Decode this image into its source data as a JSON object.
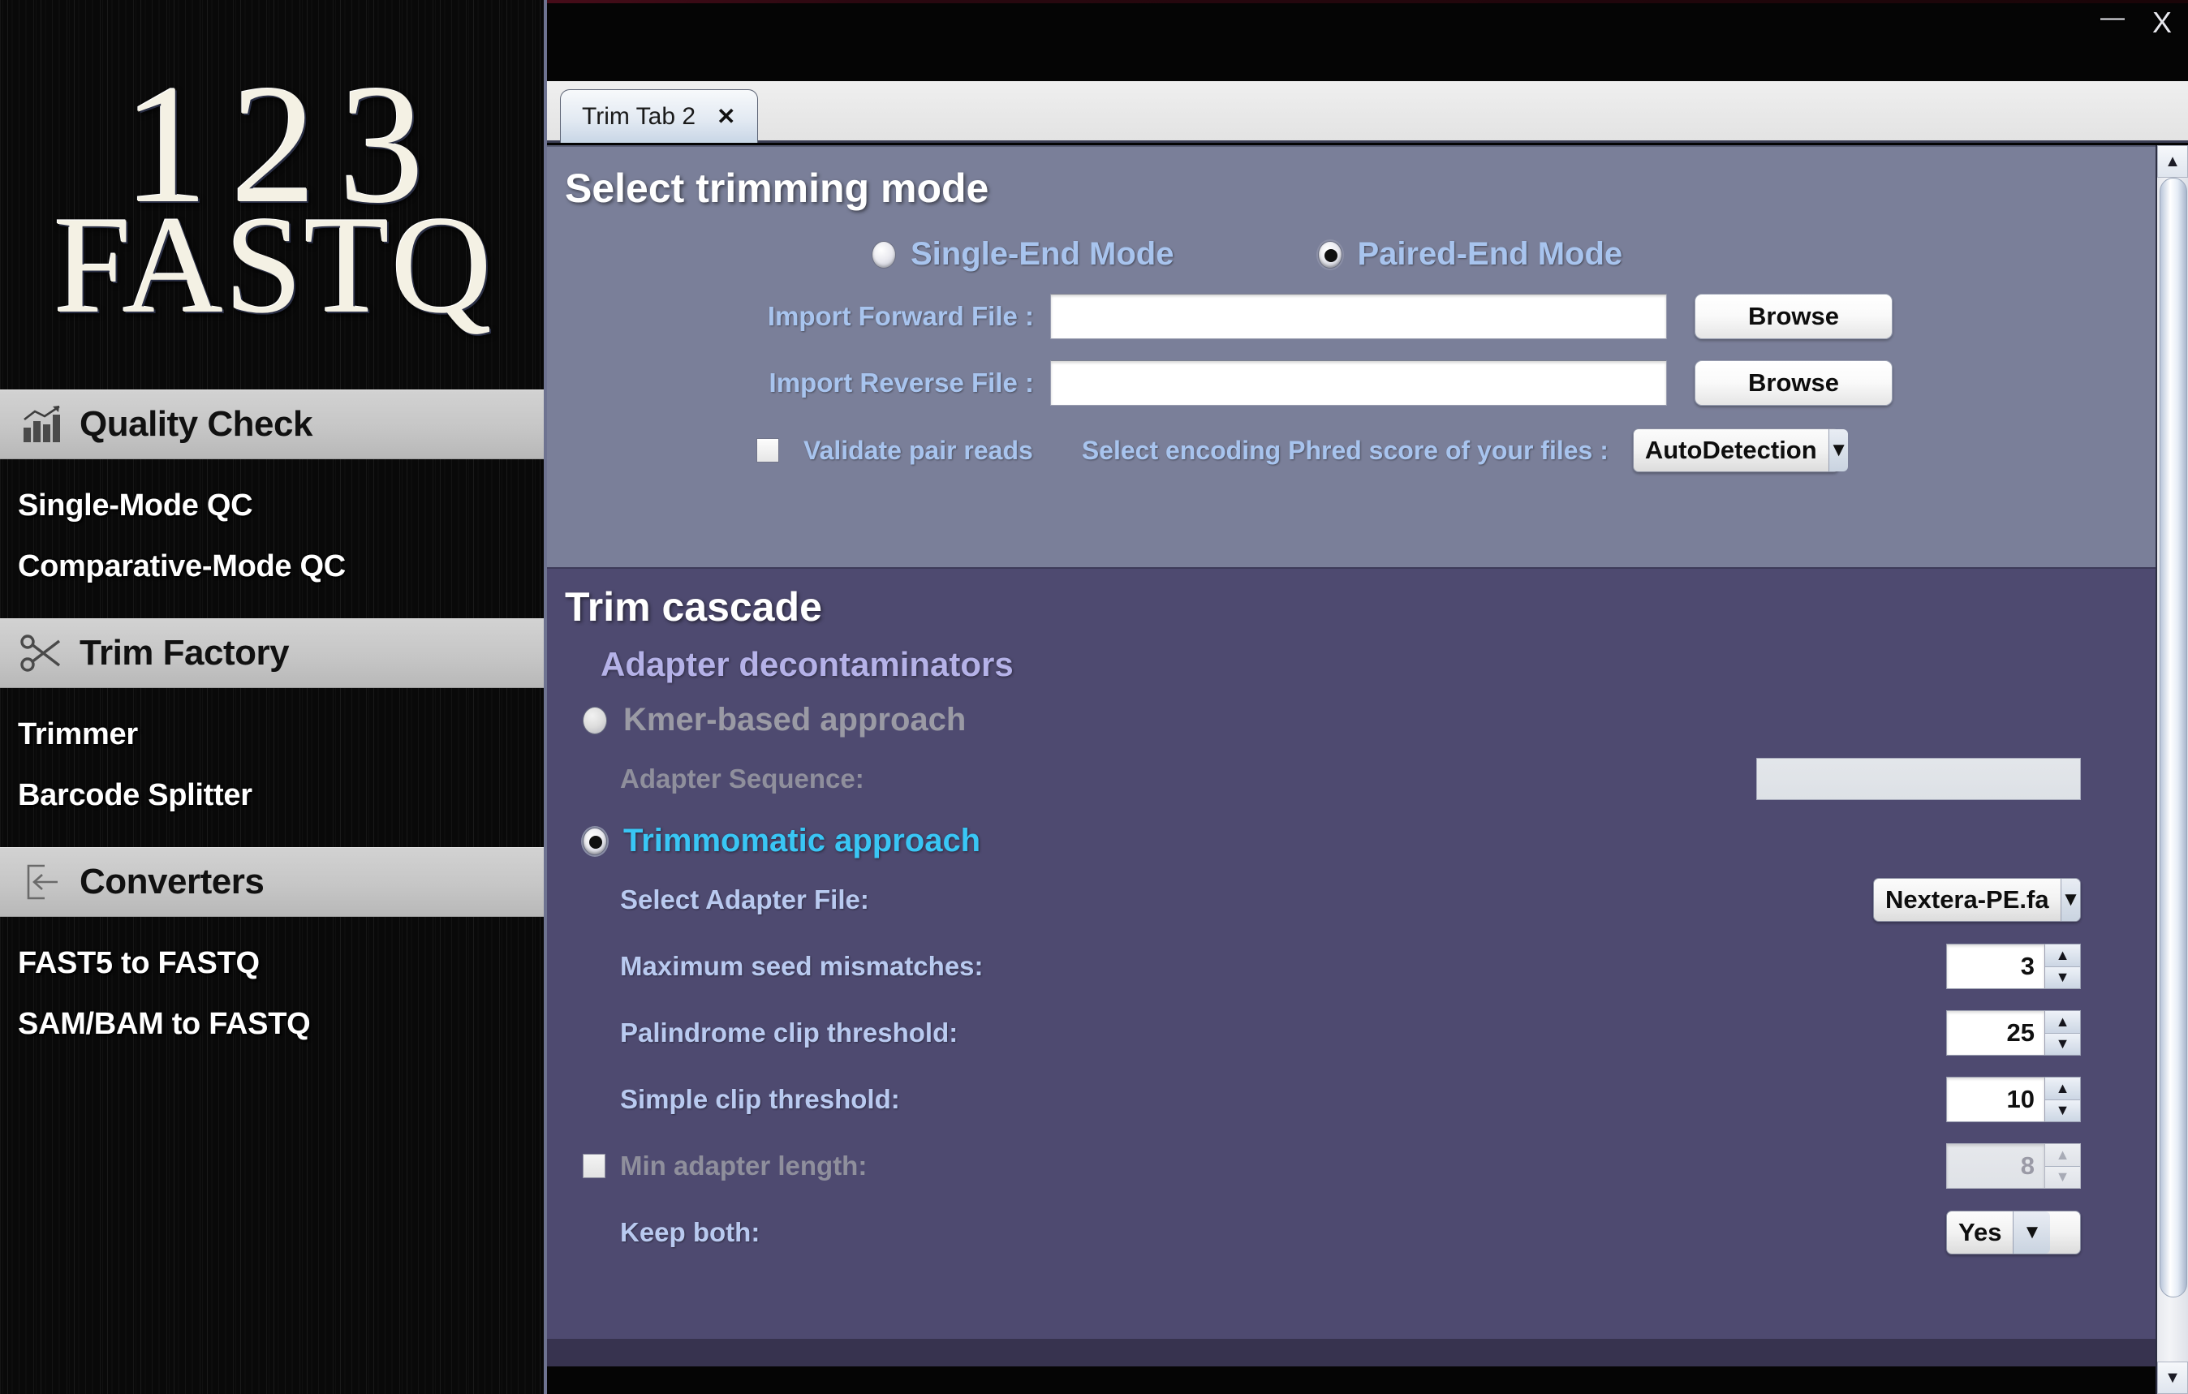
{
  "window": {
    "minimize_label": "—",
    "close_label": "X"
  },
  "sidebar": {
    "logo": {
      "line1": "123",
      "line2": "FASTQ"
    },
    "sections": [
      {
        "title": "Quality Check",
        "icon": "bar-chart-icon",
        "items": [
          "Single-Mode QC",
          "Comparative-Mode QC"
        ]
      },
      {
        "title": "Trim Factory",
        "icon": "scissors-icon",
        "items": [
          "Trimmer",
          "Barcode Splitter"
        ]
      },
      {
        "title": "Converters",
        "icon": "import-arrow-icon",
        "items": [
          "FAST5 to FASTQ",
          "SAM/BAM to FASTQ"
        ]
      }
    ]
  },
  "tabs": [
    {
      "label": "Trim Tab 2",
      "close_label": "✕",
      "active": true
    }
  ],
  "trimming_mode": {
    "heading": "Select trimming mode",
    "modes": [
      {
        "label": "Single-End Mode",
        "selected": false
      },
      {
        "label": "Paired-End Mode",
        "selected": true
      }
    ],
    "forward_file": {
      "label": "Import Forward File :",
      "value": "",
      "browse_label": "Browse"
    },
    "reverse_file": {
      "label": "Import Reverse File :",
      "value": "",
      "browse_label": "Browse"
    },
    "validate_pair_reads": {
      "label": "Validate pair reads",
      "checked": false
    },
    "encoding": {
      "label": "Select encoding Phred score of your files :",
      "value": "AutoDetection",
      "arrow": "▼"
    }
  },
  "trim_cascade": {
    "heading": "Trim cascade",
    "subheading": "Adapter decontaminators",
    "kmer": {
      "label": "Kmer-based approach",
      "selected": false,
      "enabled": false,
      "adapter_sequence_label": "Adapter Sequence:",
      "adapter_sequence_value": ""
    },
    "trimmomatic": {
      "label": "Trimmomatic approach",
      "selected": true,
      "enabled": true,
      "params": [
        {
          "label": "Select Adapter File:",
          "type": "dropdown",
          "value": "Nextera-PE.fa",
          "arrow": "▼",
          "enabled": true,
          "checkbox": null
        },
        {
          "label": "Maximum seed mismatches:",
          "type": "spinner",
          "value": "3",
          "enabled": true,
          "checkbox": null
        },
        {
          "label": "Palindrome clip threshold:",
          "type": "spinner",
          "value": "25",
          "enabled": true,
          "checkbox": null
        },
        {
          "label": "Simple clip threshold:",
          "type": "spinner",
          "value": "10",
          "enabled": true,
          "checkbox": null
        },
        {
          "label": "Min adapter length:",
          "type": "spinner",
          "value": "8",
          "enabled": false,
          "checkbox": false
        },
        {
          "label": "Keep both:",
          "type": "dropdown",
          "value": "Yes",
          "arrow": "▼",
          "enabled": true,
          "checkbox": null
        }
      ]
    }
  },
  "scrollbar": {
    "up_arrow": "▲",
    "down_arrow": "▼"
  },
  "colors": {
    "panel_top_bg": "#7a7f99",
    "panel_bottom_bg": "#4e4a70",
    "label_blue": "#a8c4ee",
    "active_cyan": "#39c6f5",
    "subheading_lavender": "#b5b2e8",
    "disabled_gray": "#9a9aa4"
  }
}
